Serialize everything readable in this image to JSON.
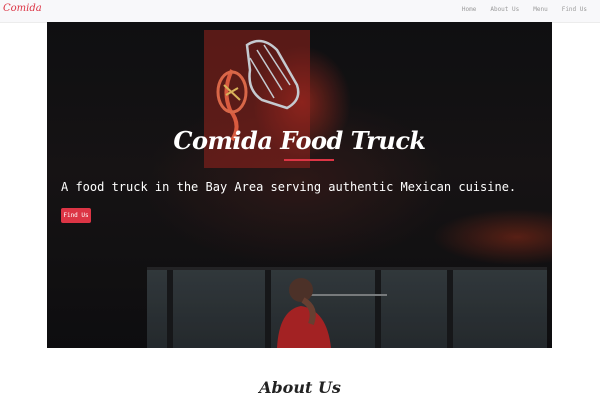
{
  "navbar": {
    "brand": "Comida",
    "links": [
      "Home",
      "About Us",
      "Menu",
      "Find Us"
    ]
  },
  "hero": {
    "title": "Comida Food Truck",
    "tagline": "A food truck in the Bay Area serving authentic Mexican cuisine.",
    "button_label": "Find Us"
  },
  "about": {
    "heading": "About Us"
  },
  "colors": {
    "accent": "#dc3545",
    "navbar_bg": "#f8f8fa",
    "hero_bg": "#141416"
  },
  "icons": {
    "neon_sign": "taco-and-hands-neon-sign"
  }
}
